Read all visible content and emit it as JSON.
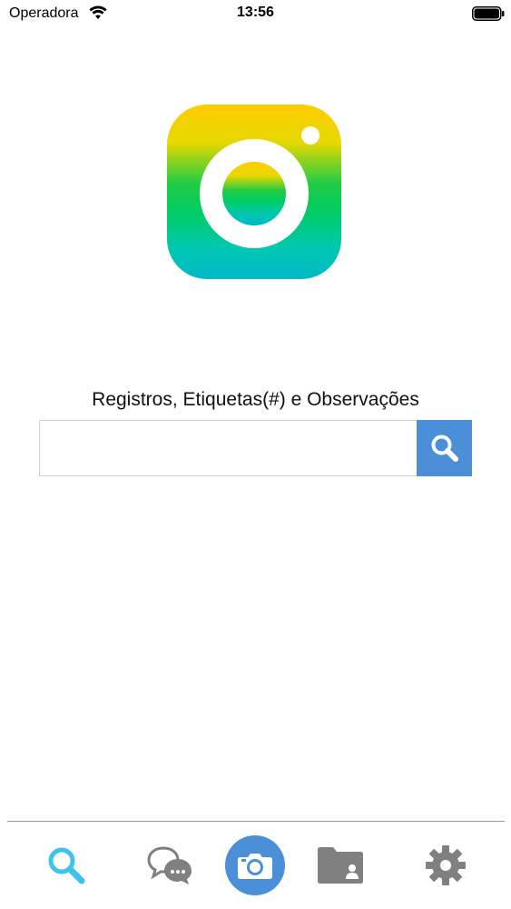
{
  "status_bar": {
    "carrier": "Operadora",
    "time": "13:56"
  },
  "search": {
    "label": "Registros, Etiquetas(#) e Observações",
    "value": "",
    "placeholder": ""
  },
  "tab_bar": {
    "items": [
      {
        "icon": "search-icon",
        "active": true
      },
      {
        "icon": "chat-bubbles-icon",
        "active": false
      },
      {
        "icon": "camera-icon",
        "active": false
      },
      {
        "icon": "contacts-folder-icon",
        "active": false
      },
      {
        "icon": "gear-icon",
        "active": false
      }
    ]
  },
  "colors": {
    "accent": "#4a8fd8",
    "active_tab": "#3cc3ee",
    "inactive_tab": "#808080",
    "logo_top": "#ffc800",
    "logo_mid": "#00cc44",
    "logo_bottom": "#00b8c8"
  }
}
